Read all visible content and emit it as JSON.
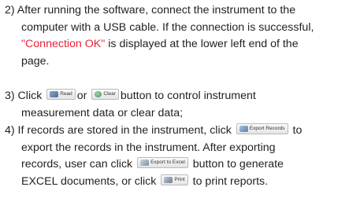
{
  "step2": {
    "line1": "2) After running the software, connect the instrument to the",
    "line2": "computer with a USB cable. If the connection is successful,",
    "line3_quote_open": "\"",
    "connection_status": "Connection OK",
    "line3_rest": "\" is displayed at the lower left end of the",
    "line4": "page."
  },
  "step3": {
    "prefix": "3) Click",
    "read_button_label": "Read",
    "middle": "or",
    "clear_button_label": "Clear",
    "suffix": "button to control instrument",
    "line2": "measurement data or clear data;"
  },
  "step4": {
    "prefix": "4) If records are stored in the instrument, click",
    "export_records_label": "Export Records",
    "after_export": "to",
    "line2": "export the records in the instrument. After exporting",
    "line3_prefix": "records, user can click",
    "export_excel_label": "Export to Excel",
    "line3_suffix": "button to generate",
    "line4_prefix": "EXCEL documents, or click",
    "print_label": "Print",
    "line4_suffix": "to print reports."
  },
  "colors": {
    "text": "#231f20",
    "accent_red": "#e8203a"
  },
  "icons": [
    "read-icon",
    "clear-icon",
    "export-records-icon",
    "export-excel-icon",
    "print-icon"
  ]
}
